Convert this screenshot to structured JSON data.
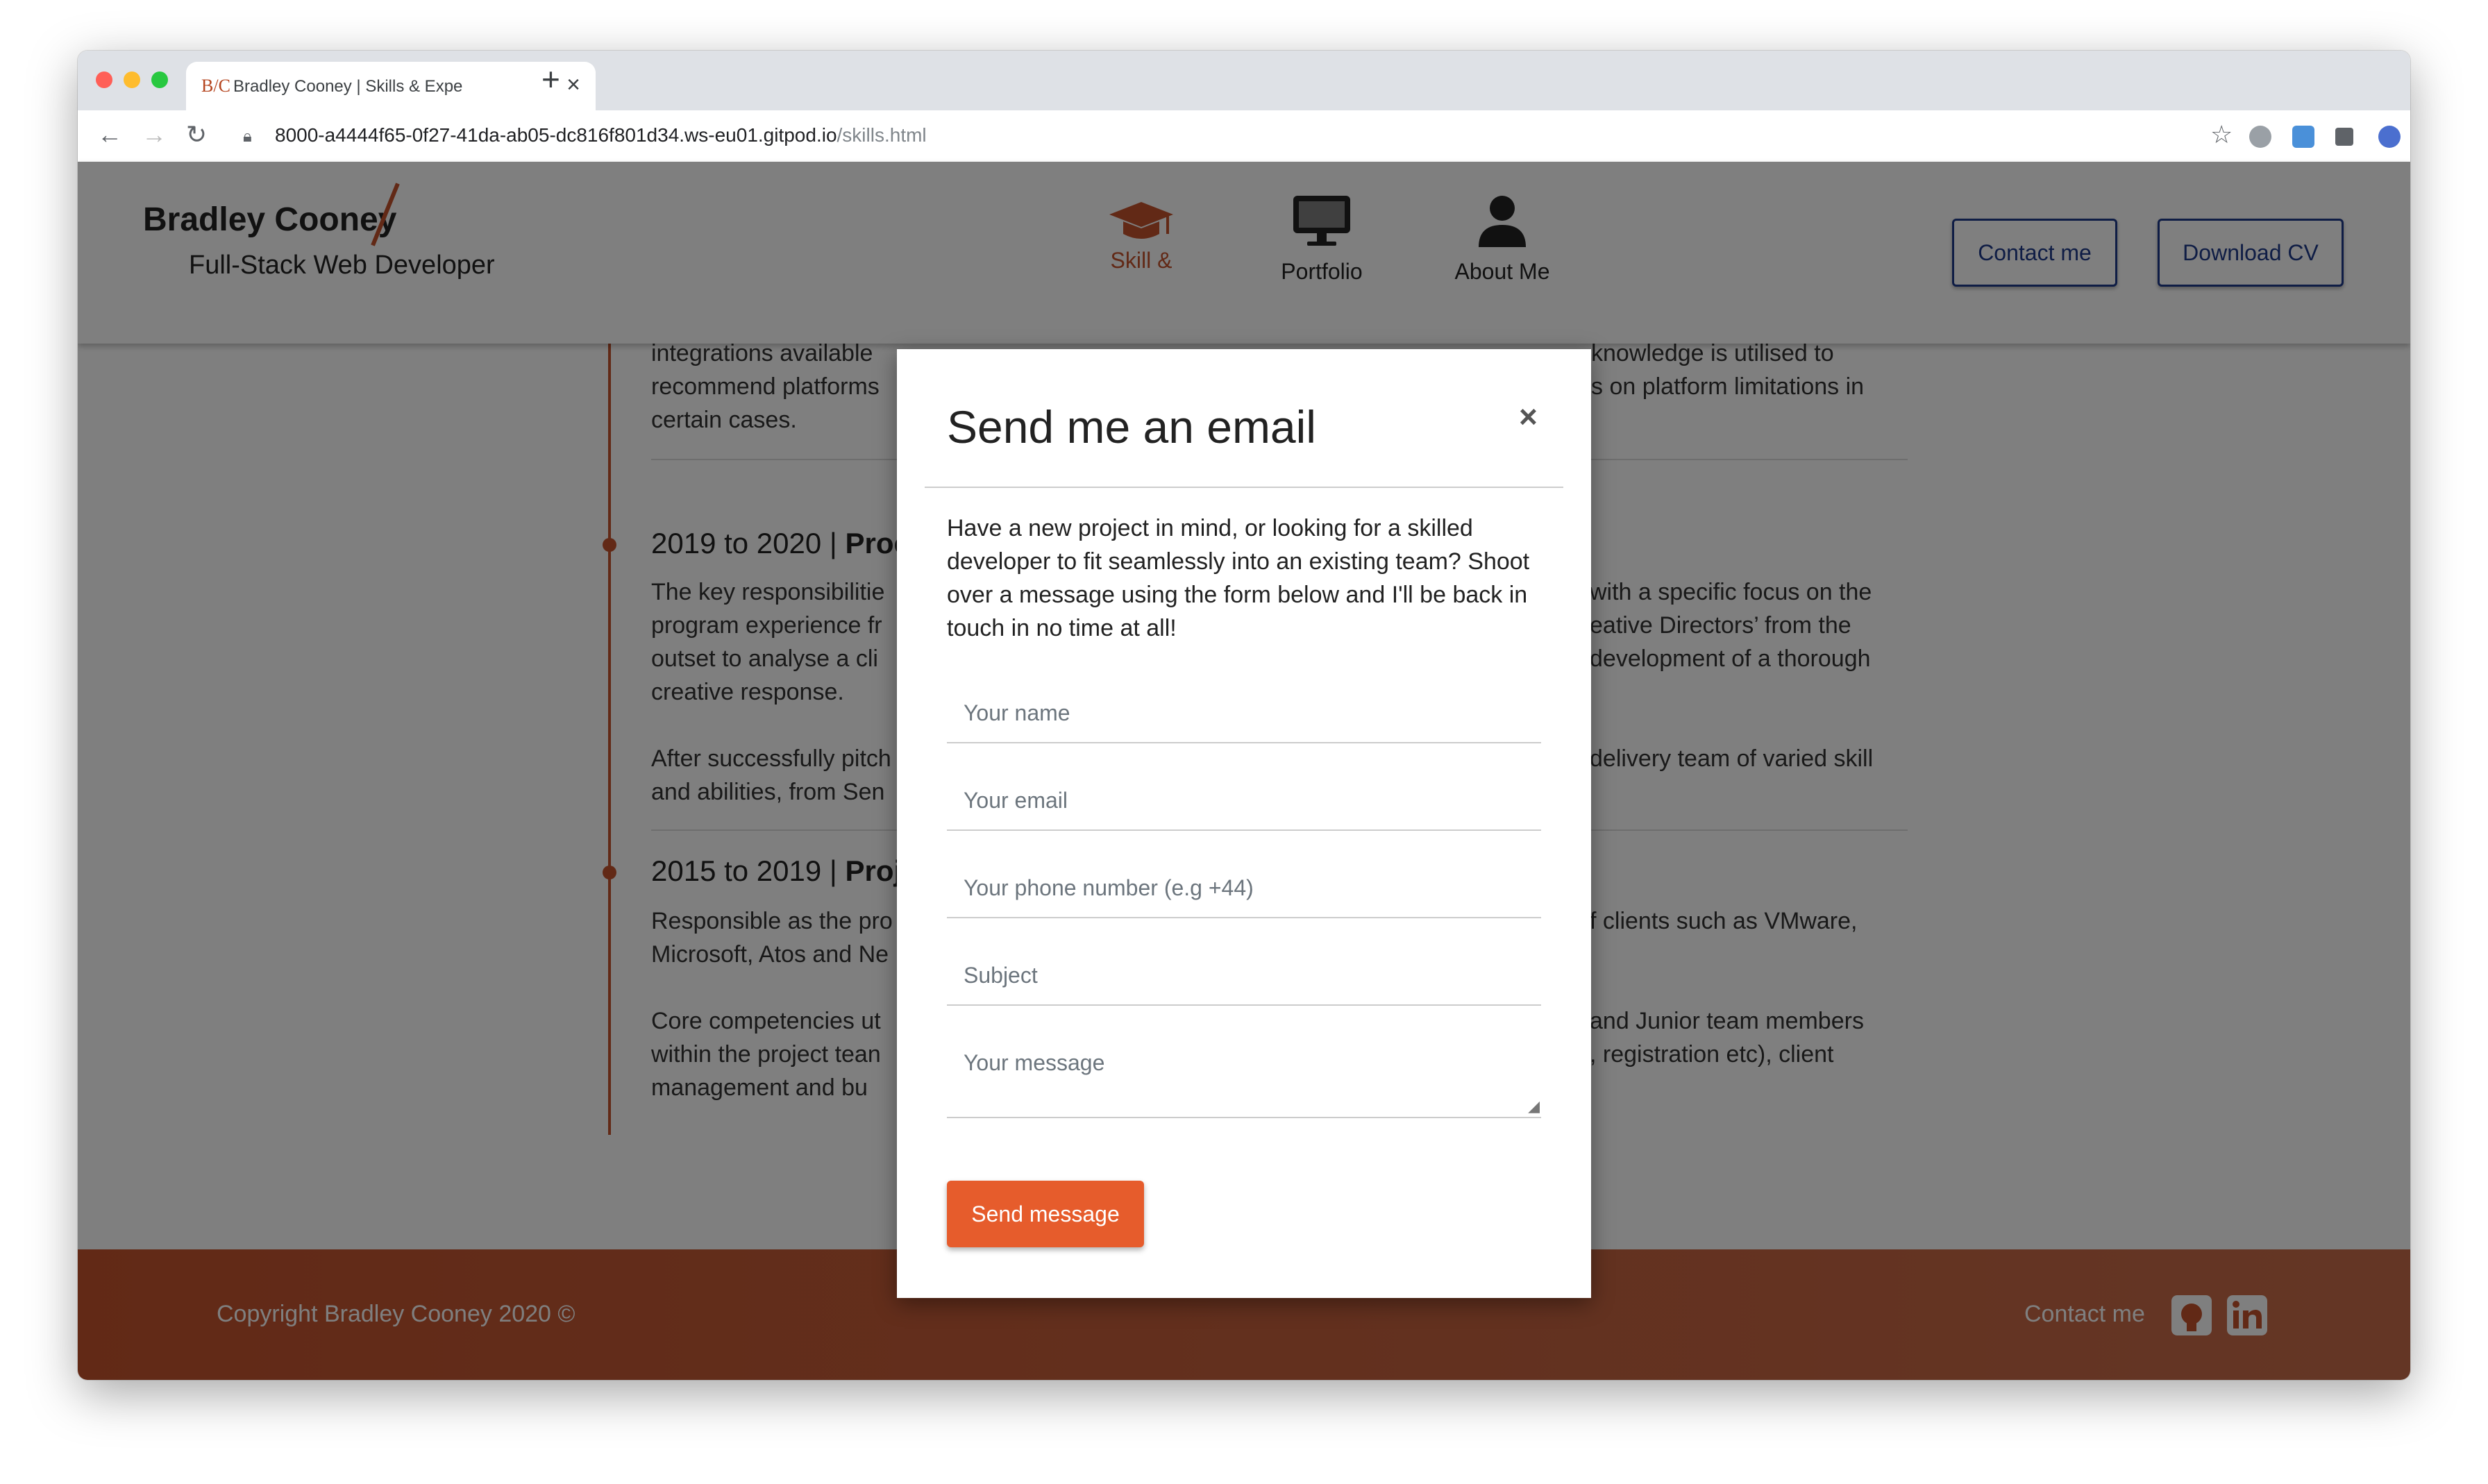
{
  "browser": {
    "tab_title": "Bradley Cooney | Skills & Expe",
    "favicon_text": "B/C",
    "url_host": "8000-a4444f65-0f27-41da-ab05-dc816f801d34.ws-eu01.gitpod.io",
    "url_path": "/skills.html"
  },
  "header": {
    "brand_name": "Bradley Cooney",
    "brand_tagline": "Full-Stack Web Developer",
    "nav": [
      {
        "label": "Skill &",
        "icon": "graduation-cap-icon",
        "active": true
      },
      {
        "label": "Portfolio",
        "icon": "desktop-monitor-icon",
        "active": false
      },
      {
        "label": "About Me",
        "icon": "user-icon",
        "active": false
      }
    ],
    "contact_button": "Contact me",
    "download_button": "Download CV"
  },
  "timeline": {
    "intro_lines": [
      "integrations available",
      "recommend platforms",
      "certain cases."
    ],
    "intro_right_lines": [
      "knowledge is utilised to",
      "s on platform limitations in"
    ],
    "entries": [
      {
        "years": "2019 to 2020 |",
        "role_fragment": "Proc",
        "para1_left": [
          "The key responsibilitie",
          "program experience fr",
          "outset to analyse a cli",
          "creative response."
        ],
        "para1_right": [
          "with a specific focus on the",
          "eative Directors’ from the",
          "development of a thorough"
        ],
        "para2_left": [
          "After successfully pitch",
          "and abilities, from Sen"
        ],
        "para2_right": [
          "delivery team of varied skill"
        ]
      },
      {
        "years": "2015 to 2019 |",
        "role_fragment": "Proje",
        "para1_left": [
          "Responsible as the pro",
          "Microsoft, Atos and Ne"
        ],
        "para1_right": [
          "f clients such as VMware,"
        ],
        "para2_left": [
          "Core competencies ut",
          "within the project tean",
          "management and bu"
        ],
        "para2_right": [
          "and Junior team members",
          ", registration etc), client"
        ]
      }
    ]
  },
  "footer": {
    "copyright": "Copyright Bradley Cooney 2020 ©",
    "contact": "Contact me",
    "icons": [
      "github-icon",
      "linkedin-icon"
    ]
  },
  "modal": {
    "title": "Send me an email",
    "close": "×",
    "body": "Have a new project in mind, or looking for a skilled developer to fit seamlessly into an existing team? Shoot over a message using the form below and I'll be back in touch in no time at all!",
    "fields": {
      "name": "Your name",
      "email": "Your email",
      "phone": "Your phone number (e.g +44)",
      "subject": "Subject",
      "message": "Your message"
    },
    "submit": "Send message"
  },
  "colors": {
    "accent": "#c4532d",
    "button_primary": "#e65c2c",
    "header_button_border": "#1e3a8a"
  }
}
